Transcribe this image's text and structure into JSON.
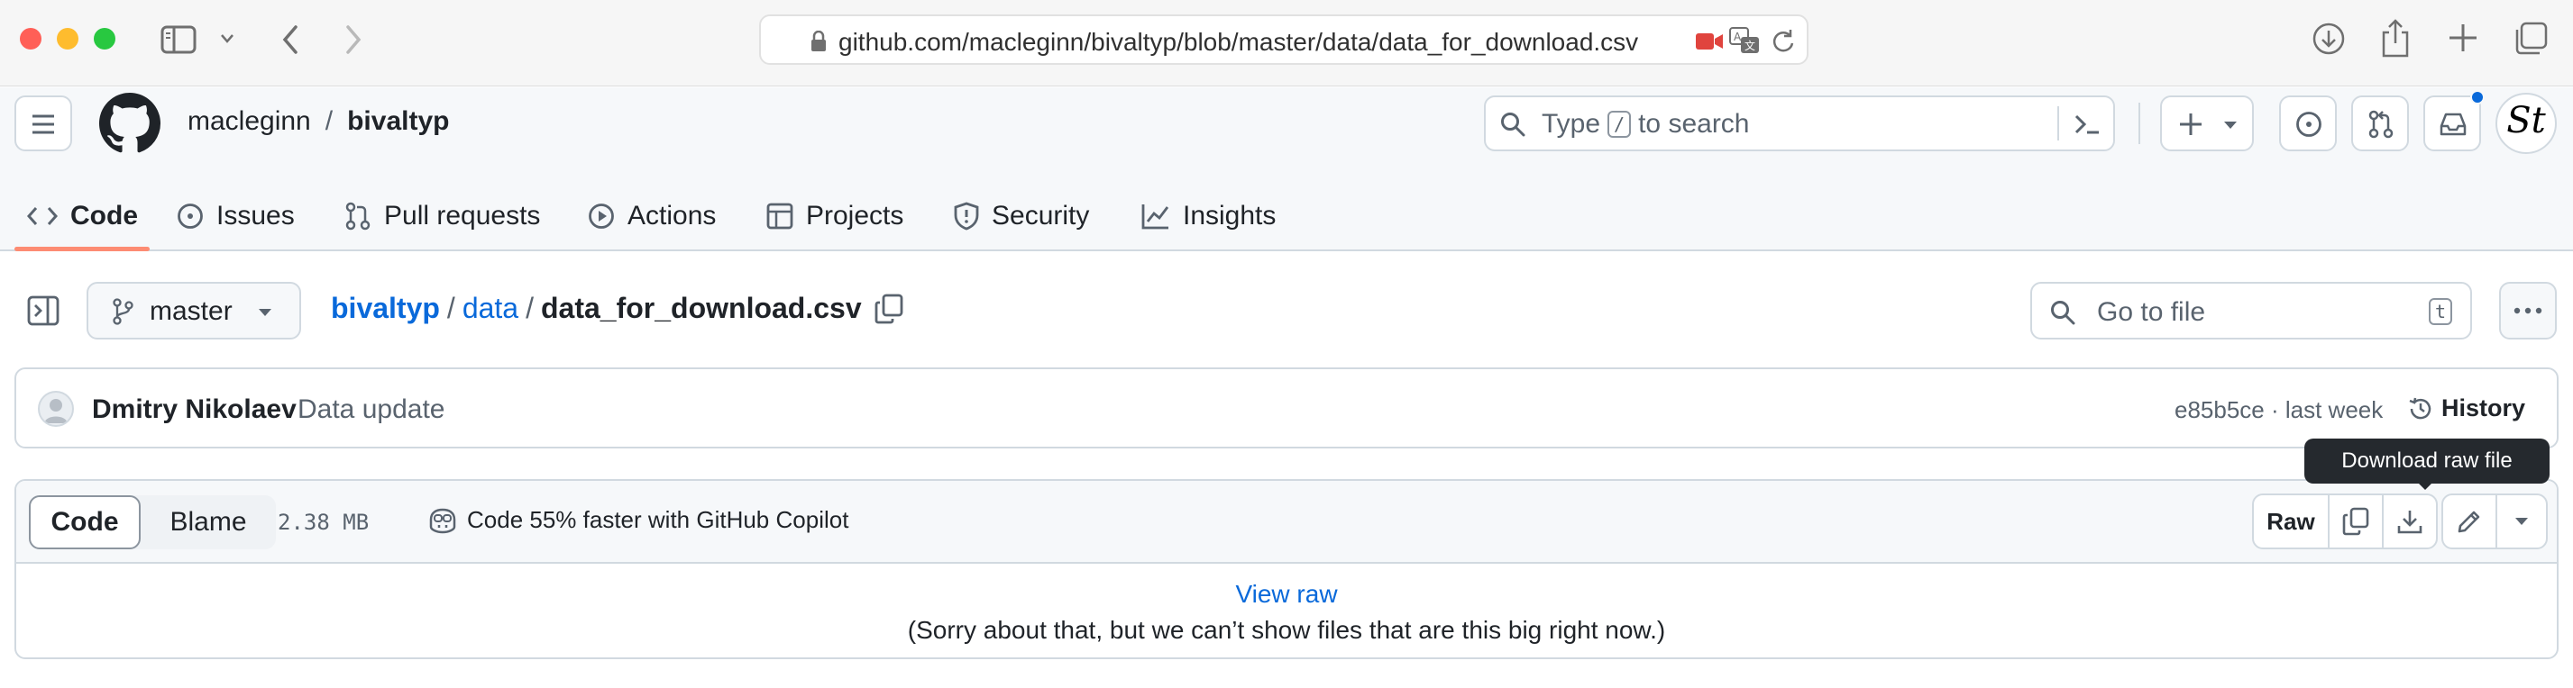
{
  "browser": {
    "url": "github.com/macleginn/bivaltyp/blob/master/data/data_for_download.csv",
    "traffic_lights": [
      "#ff5f57",
      "#febc2e",
      "#28c840"
    ]
  },
  "header": {
    "owner": "macleginn",
    "separator": "/",
    "repo": "bivaltyp",
    "search_prefix": "Type",
    "search_key": "/",
    "search_suffix": "to search",
    "avatar_text": "St"
  },
  "repo_tabs": [
    {
      "label": "Code",
      "icon": "code-icon"
    },
    {
      "label": "Issues",
      "icon": "issue-icon"
    },
    {
      "label": "Pull requests",
      "icon": "pull-request-icon"
    },
    {
      "label": "Actions",
      "icon": "play-icon"
    },
    {
      "label": "Projects",
      "icon": "table-icon"
    },
    {
      "label": "Security",
      "icon": "shield-icon"
    },
    {
      "label": "Insights",
      "icon": "graph-icon"
    }
  ],
  "file_nav": {
    "branch": "master",
    "breadcrumb": [
      "bivaltyp",
      "data"
    ],
    "filename": "data_for_download.csv",
    "sep": "/",
    "goto_placeholder": "Go to file",
    "goto_key": "t"
  },
  "commit": {
    "author": "Dmitry Nikolaev",
    "message": "Data update",
    "sha_time": "e85b5ce · last week",
    "history_label": "History"
  },
  "file_view": {
    "tab_code": "Code",
    "tab_blame": "Blame",
    "size": "2.38 MB",
    "copilot": "Code 55% faster with GitHub Copilot",
    "raw_label": "Raw",
    "tooltip": "Download raw file",
    "view_raw": "View raw",
    "too_big": "(Sorry about that, but we can’t show files that are this big right now.)"
  },
  "colors": {
    "accent_underline": "#fd8c73",
    "link": "#0969da",
    "notification_dot": "#0969da"
  }
}
